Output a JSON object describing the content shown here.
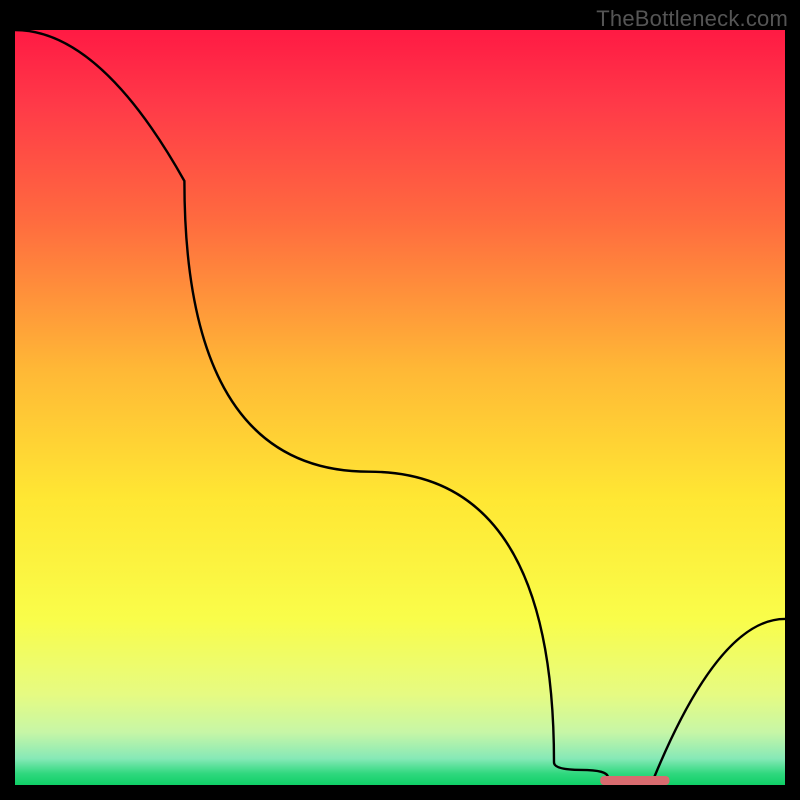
{
  "watermark": "TheBottleneck.com",
  "chart_data": {
    "type": "line",
    "title": "",
    "xlabel": "",
    "ylabel": "",
    "xlim": [
      0,
      100
    ],
    "ylim": [
      0,
      100
    ],
    "x": [
      0,
      22,
      70,
      77,
      83,
      100
    ],
    "values": [
      100,
      80,
      3,
      1,
      1,
      22
    ],
    "marker": {
      "x_start": 76,
      "x_end": 85,
      "y": 0.6,
      "color": "#d86b6f"
    },
    "background_gradient": {
      "stops": [
        {
          "offset": 0.0,
          "color": "#ff1a44"
        },
        {
          "offset": 0.1,
          "color": "#ff3a48"
        },
        {
          "offset": 0.25,
          "color": "#ff6a3f"
        },
        {
          "offset": 0.45,
          "color": "#ffb836"
        },
        {
          "offset": 0.62,
          "color": "#ffe733"
        },
        {
          "offset": 0.78,
          "color": "#f9fd4a"
        },
        {
          "offset": 0.88,
          "color": "#e6fb82"
        },
        {
          "offset": 0.93,
          "color": "#c7f6a6"
        },
        {
          "offset": 0.965,
          "color": "#86e9b7"
        },
        {
          "offset": 0.985,
          "color": "#2fd87e"
        },
        {
          "offset": 1.0,
          "color": "#0fcf66"
        }
      ]
    }
  }
}
